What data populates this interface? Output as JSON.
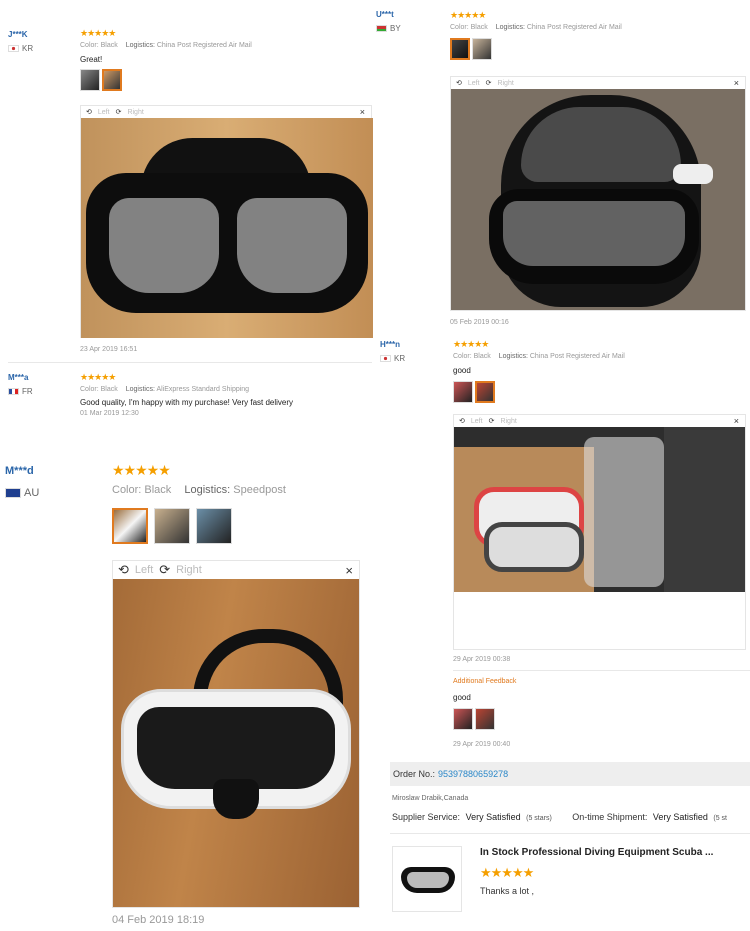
{
  "reviews_left": [
    {
      "user": "J***K",
      "country": "KR",
      "stars": "★★★★★",
      "color_label": "Color:",
      "color": "Black",
      "logistics_label": "Logistics:",
      "logistics": "China Post Registered Air Mail",
      "text": "Great!",
      "date": "23 Apr 2019 16:51"
    },
    {
      "user": "M***a",
      "country": "FR",
      "stars": "★★★★★",
      "color_label": "Color:",
      "color": "Black",
      "logistics_label": "Logistics:",
      "logistics": "AliExpress Standard Shipping",
      "text": "Good quality, I'm happy with my purchase! Very fast delivery",
      "date": "01 Mar 2019 12:30"
    },
    {
      "user": "M***d",
      "country": "AU",
      "stars": "★★★★★",
      "color_label": "Color:",
      "color": "Black",
      "logistics_label": "Logistics:",
      "logistics": "Speedpost",
      "date": "04 Feb 2019 18:19"
    }
  ],
  "reviews_right": [
    {
      "user": "U***t",
      "country": "BY",
      "stars": "★★★★★",
      "color_label": "Color:",
      "color": "Black",
      "logistics_label": "Logistics:",
      "logistics": "China Post Registered Air Mail",
      "date": "05 Feb 2019 00:16"
    },
    {
      "user": "H***n",
      "country": "KR",
      "stars": "★★★★★",
      "color_label": "Color:",
      "color": "Black",
      "logistics_label": "Logistics:",
      "logistics": "China Post Registered Air Mail",
      "text": "good",
      "date": "29 Apr 2019 00:38",
      "additional_label": "Additional Feedback",
      "additional_text": "good",
      "additional_date": "29 Apr 2019 00:40"
    }
  ],
  "viewer": {
    "left": "Left",
    "right": "Right",
    "close": "×"
  },
  "order": {
    "label": "Order No.:",
    "number": "95397880659278",
    "buyer": "Miroslaw Drabik,Canada",
    "supplier_label": "Supplier Service:",
    "supplier_value": "Very Satisfied",
    "supplier_stars": "(5 stars)",
    "shipment_label": "On-time Shipment:",
    "shipment_value": "Very Satisfied",
    "shipment_stars": "(5 st",
    "product_title": "In Stock Professional Diving Equipment Scuba ...",
    "stars": "★★★★★",
    "comment": "Thanks a lot ,"
  },
  "colors": {
    "accent": "#e07a1f",
    "link": "#2a65a9",
    "star": "#f59f00"
  }
}
